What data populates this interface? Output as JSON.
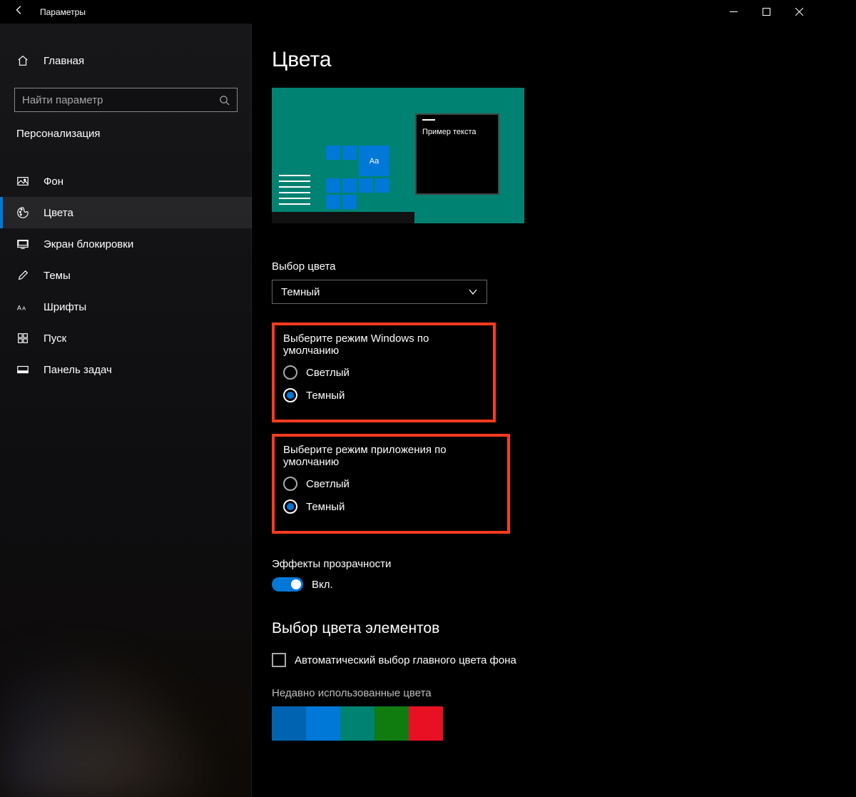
{
  "window": {
    "title": "Параметры"
  },
  "sidebar": {
    "home": "Главная",
    "search_placeholder": "Найти параметр",
    "category": "Персонализация",
    "items": [
      {
        "id": "background",
        "label": "Фон"
      },
      {
        "id": "colors",
        "label": "Цвета"
      },
      {
        "id": "lockscreen",
        "label": "Экран блокировки"
      },
      {
        "id": "themes",
        "label": "Темы"
      },
      {
        "id": "fonts",
        "label": "Шрифты"
      },
      {
        "id": "start",
        "label": "Пуск"
      },
      {
        "id": "taskbar",
        "label": "Панель задач"
      }
    ],
    "active_index": 1
  },
  "main": {
    "page_title": "Цвета",
    "preview": {
      "sample_text": "Пример текста",
      "tile_text": "Aa"
    },
    "color_mode": {
      "label": "Выбор цвета",
      "value": "Темный"
    },
    "windows_mode": {
      "label": "Выберите режим Windows по умолчанию",
      "options": {
        "light": "Светлый",
        "dark": "Темный"
      },
      "selected": "dark"
    },
    "app_mode": {
      "label": "Выберите режим приложения по умолчанию",
      "options": {
        "light": "Светлый",
        "dark": "Темный"
      },
      "selected": "dark"
    },
    "transparency": {
      "label": "Эффекты прозрачности",
      "state_label": "Вкл.",
      "on": true
    },
    "accent": {
      "heading": "Выбор цвета элементов",
      "auto_checkbox": "Автоматический выбор главного цвета фона",
      "auto_checked": false,
      "recent_label": "Недавно использованные цвета",
      "recent_colors": [
        "#0063b1",
        "#0078d7",
        "#008272",
        "#107c10",
        "#e81123"
      ]
    }
  }
}
